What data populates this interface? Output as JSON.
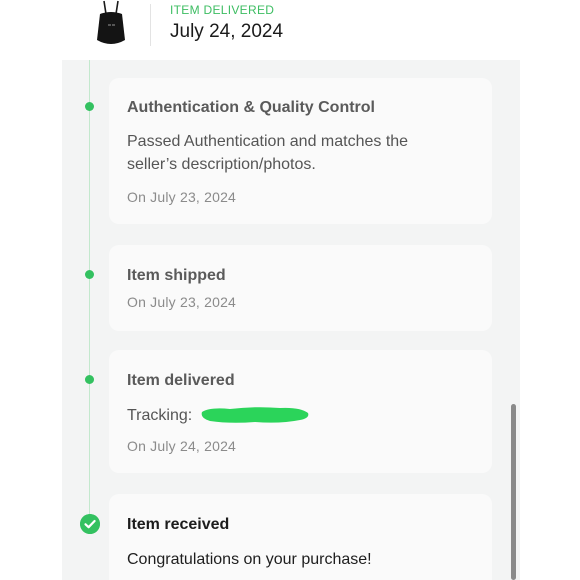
{
  "header": {
    "status_label": "ITEM DELIVERED",
    "status_date": "July 24, 2024",
    "status_color": "#3dbd62",
    "thumbnail_icon": "black-bag-image"
  },
  "timeline": {
    "accent_color": "#33c160",
    "steps": [
      {
        "title": "Authentication & Quality Control",
        "body_line1": "Passed Authentication and matches the",
        "body_line2": "seller’s description/photos.",
        "date": "On July 23, 2024"
      },
      {
        "title": "Item shipped",
        "date": "On July 23, 2024"
      },
      {
        "title": "Item delivered",
        "tracking_label": "Tracking:",
        "date": "On July 24, 2024"
      },
      {
        "title": "Item received",
        "body": "Congratulations on your purchase!",
        "status_icon": "check-circle-icon"
      }
    ]
  }
}
